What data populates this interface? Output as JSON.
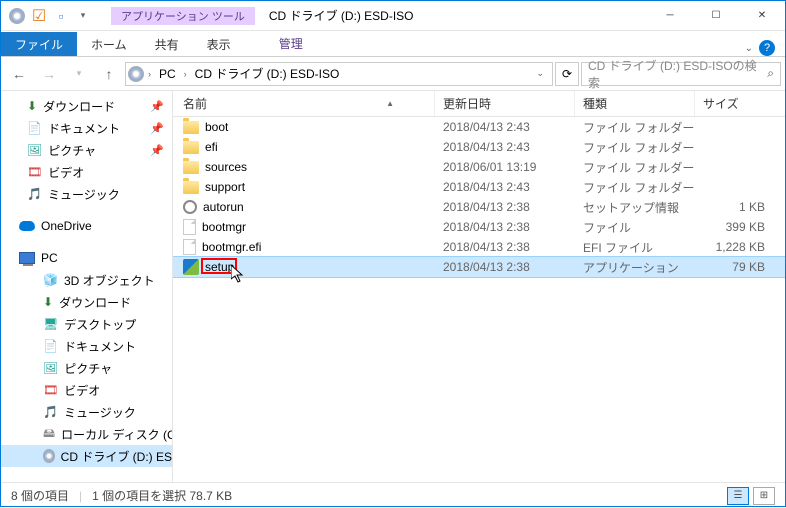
{
  "titlebar": {
    "tools_label": "アプリケーション ツール",
    "title": "CD ドライブ (D:) ESD-ISO"
  },
  "ribbon": {
    "file": "ファイル",
    "home": "ホーム",
    "share": "共有",
    "view": "表示",
    "manage": "管理"
  },
  "address": {
    "pc": "PC",
    "location": "CD ドライブ (D:) ESD-ISO"
  },
  "search": {
    "placeholder": "CD ドライブ (D:) ESD-ISOの検索"
  },
  "sidebar": {
    "downloads": "ダウンロード",
    "documents": "ドキュメント",
    "pictures": "ピクチャ",
    "videos": "ビデオ",
    "music": "ミュージック",
    "onedrive": "OneDrive",
    "pc": "PC",
    "objects3d": "3D オブジェクト",
    "downloads2": "ダウンロード",
    "desktop2": "デスクトップ",
    "documents2": "ドキュメント",
    "pictures2": "ピクチャ",
    "videos2": "ビデオ",
    "music2": "ミュージック",
    "localdisk": "ローカル ディスク (C",
    "cddrive": "CD ドライブ (D:) ES"
  },
  "columns": {
    "name": "名前",
    "date": "更新日時",
    "type": "種類",
    "size": "サイズ"
  },
  "files": [
    {
      "name": "boot",
      "date": "2018/04/13 2:43",
      "type": "ファイル フォルダー",
      "size": "",
      "icon": "folder"
    },
    {
      "name": "efi",
      "date": "2018/04/13 2:43",
      "type": "ファイル フォルダー",
      "size": "",
      "icon": "folder"
    },
    {
      "name": "sources",
      "date": "2018/06/01 13:19",
      "type": "ファイル フォルダー",
      "size": "",
      "icon": "folder"
    },
    {
      "name": "support",
      "date": "2018/04/13 2:43",
      "type": "ファイル フォルダー",
      "size": "",
      "icon": "folder"
    },
    {
      "name": "autorun",
      "date": "2018/04/13 2:38",
      "type": "セットアップ情報",
      "size": "1 KB",
      "icon": "gear"
    },
    {
      "name": "bootmgr",
      "date": "2018/04/13 2:38",
      "type": "ファイル",
      "size": "399 KB",
      "icon": "file"
    },
    {
      "name": "bootmgr.efi",
      "date": "2018/04/13 2:38",
      "type": "EFI ファイル",
      "size": "1,228 KB",
      "icon": "file"
    },
    {
      "name": "setup",
      "date": "2018/04/13 2:38",
      "type": "アプリケーション",
      "size": "79 KB",
      "icon": "setup",
      "selected": true
    }
  ],
  "status": {
    "count": "8 個の項目",
    "selection": "1 個の項目を選択 78.7 KB"
  }
}
